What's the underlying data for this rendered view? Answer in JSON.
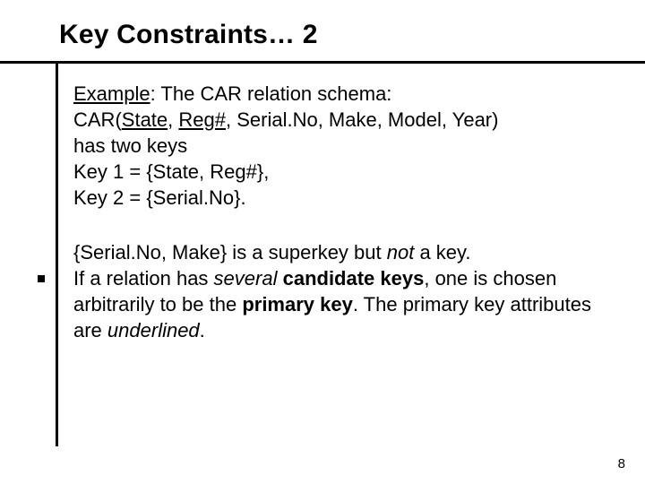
{
  "title": "Key Constraints… 2",
  "p1": {
    "t1a": "Example",
    "t1b": ": The CAR relation schema:",
    "t2a": "CAR(",
    "t2_state": "State",
    "t2_c1": ", ",
    "t2_reg": "Reg#",
    "t2b": ", Serial.No, Make, Model, Year)",
    "t3": "has two keys",
    "t4": "Key 1 = {State, Reg#},",
    "t5": "Key 2 = {Serial.No}."
  },
  "p2": {
    "l1a": "{Serial.No, Make} is a superkey but ",
    "l1_not": "not",
    "l1b": "  a key.",
    "l2a": "If a relation has ",
    "l2_several": "several",
    "l2b": "  ",
    "l2_cand": "candidate keys",
    "l2c": ", one is chosen arbitrarily to be the ",
    "l2_pk": "primary key",
    "l2d": ". The primary key attributes are ",
    "l2_und": "underlined",
    "l2e": "."
  },
  "pagenum": "8"
}
